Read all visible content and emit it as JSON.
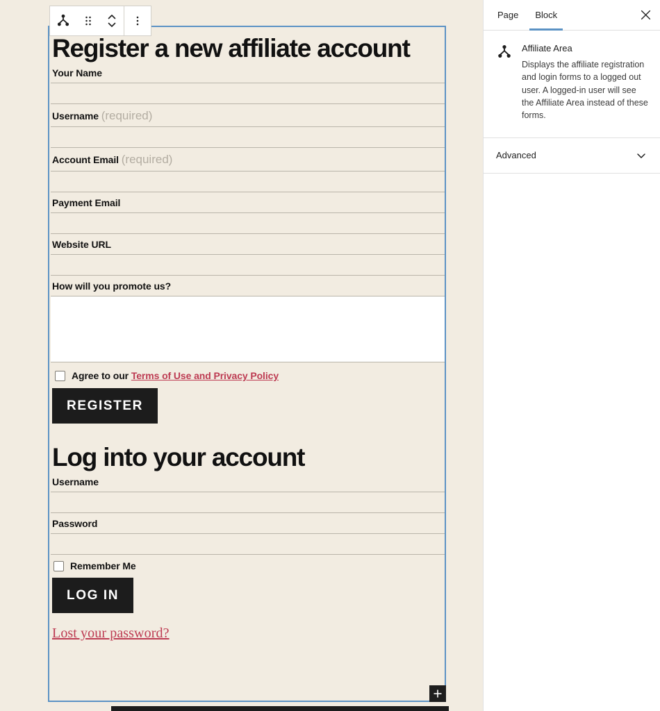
{
  "editor": {
    "toolbar": {
      "block_icon": "affiliate-area-icon",
      "drag_handle": "drag-handle-icon",
      "move_up": "chevron-up-icon",
      "move_down": "chevron-down-icon",
      "options": "more-options-vertical-icon"
    },
    "add_block_label": "+"
  },
  "register": {
    "heading": "Register a new affiliate account",
    "fields": [
      {
        "label": "Your Name",
        "required_note": "",
        "value": "",
        "type": "text"
      },
      {
        "label": "Username",
        "required_note": "(required)",
        "value": "",
        "type": "text"
      },
      {
        "label": "Account Email",
        "required_note": "(required)",
        "value": "",
        "type": "text"
      },
      {
        "label": "Payment Email",
        "required_note": "",
        "value": "",
        "type": "text"
      },
      {
        "label": "Website URL",
        "required_note": "",
        "value": "",
        "type": "text"
      },
      {
        "label": "How will you promote us?",
        "required_note": "",
        "value": "",
        "type": "textarea"
      }
    ],
    "agree_prefix": "Agree to our",
    "agree_link": "Terms of Use and Privacy Policy",
    "submit_label": "REGISTER"
  },
  "login": {
    "heading": "Log into your account",
    "fields": [
      {
        "label": "Username",
        "value": "",
        "type": "text"
      },
      {
        "label": "Password",
        "value": "",
        "type": "password"
      }
    ],
    "remember_label": "Remember Me",
    "submit_label": "LOG IN",
    "lost_password": "Lost your password?"
  },
  "sidebar": {
    "tabs": [
      {
        "label": "Page",
        "active": false
      },
      {
        "label": "Block",
        "active": true
      }
    ],
    "close_label": "Close settings",
    "block_card": {
      "icon": "affiliate-area-icon",
      "title": "Affiliate Area",
      "description": "Displays the affiliate registration and login forms to a logged out user. A logged-in user will see the Affiliate Area instead of these forms."
    },
    "panels": [
      {
        "label": "Advanced",
        "expanded": false
      }
    ]
  },
  "colors": {
    "canvas_bg": "#f2ece1",
    "selection_blue": "#5b92c4",
    "link_red": "#bd3b52",
    "button_dark": "#1c1c1c",
    "required_gray": "#b3ada2"
  }
}
